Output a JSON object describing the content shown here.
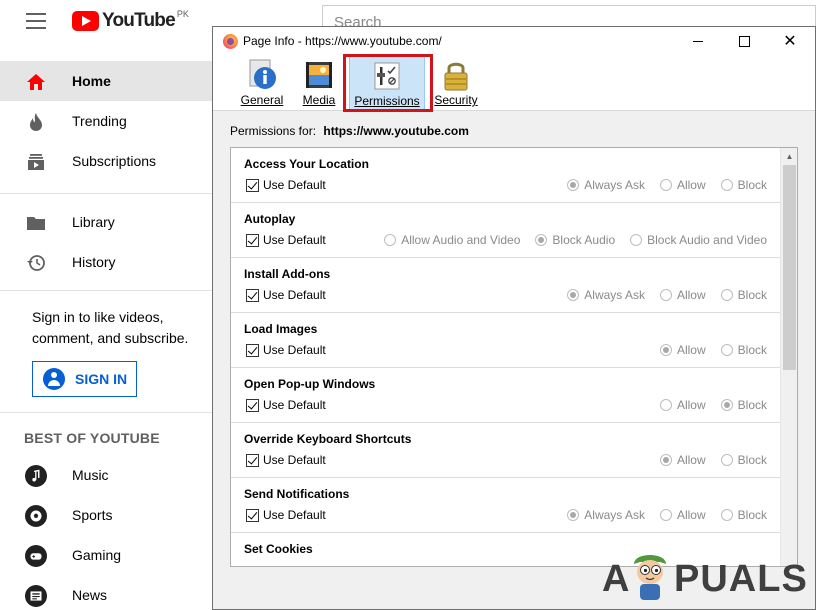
{
  "youtube": {
    "logo_word": "YouTube",
    "logo_region": "PK",
    "search_placeholder": "Search",
    "nav": [
      {
        "label": "Home",
        "icon": "home-icon",
        "active": true
      },
      {
        "label": "Trending",
        "icon": "flame-icon"
      },
      {
        "label": "Subscriptions",
        "icon": "subscriptions-icon"
      },
      {
        "label": "Library",
        "icon": "folder-icon"
      },
      {
        "label": "History",
        "icon": "history-icon"
      }
    ],
    "signin_prompt": "Sign in to like videos, comment, and subscribe.",
    "signin_button": "SIGN IN",
    "best_of_title": "BEST OF YOUTUBE",
    "best_of": [
      {
        "label": "Music",
        "icon": "music-icon"
      },
      {
        "label": "Sports",
        "icon": "sports-icon"
      },
      {
        "label": "Gaming",
        "icon": "gaming-icon"
      },
      {
        "label": "News",
        "icon": "news-icon"
      }
    ],
    "accent_color": "#ff0000"
  },
  "dialog": {
    "title": "Page Info - https://www.youtube.com/",
    "tabs": [
      {
        "label": "General",
        "icon": "info-icon"
      },
      {
        "label": "Media",
        "icon": "media-icon"
      },
      {
        "label": "Permissions",
        "icon": "permissions-icon",
        "selected": true
      },
      {
        "label": "Security",
        "icon": "padlock-icon"
      }
    ],
    "permissions_for_label": "Permissions for:",
    "permissions_for_url": "https://www.youtube.com",
    "use_default_label": "Use Default",
    "permissions": [
      {
        "name": "Access Your Location",
        "options": [
          "Always Ask",
          "Allow",
          "Block"
        ],
        "selected": "Always Ask"
      },
      {
        "name": "Autoplay",
        "options": [
          "Allow Audio and Video",
          "Block Audio",
          "Block Audio and Video"
        ],
        "selected": "Block Audio"
      },
      {
        "name": "Install Add-ons",
        "options": [
          "Always Ask",
          "Allow",
          "Block"
        ],
        "selected": "Always Ask"
      },
      {
        "name": "Load Images",
        "options": [
          "Allow",
          "Block"
        ],
        "selected": "Allow"
      },
      {
        "name": "Open Pop-up Windows",
        "options": [
          "Allow",
          "Block"
        ],
        "selected": "Block"
      },
      {
        "name": "Override Keyboard Shortcuts",
        "options": [
          "Allow",
          "Block"
        ],
        "selected": "Allow"
      },
      {
        "name": "Send Notifications",
        "options": [
          "Always Ask",
          "Allow",
          "Block"
        ],
        "selected": "Always Ask"
      },
      {
        "name": "Set Cookies",
        "options": [],
        "selected": ""
      }
    ],
    "highlight_color": "#d1141b"
  },
  "watermark": {
    "text_a": "A",
    "text_rest": "PUALS"
  }
}
